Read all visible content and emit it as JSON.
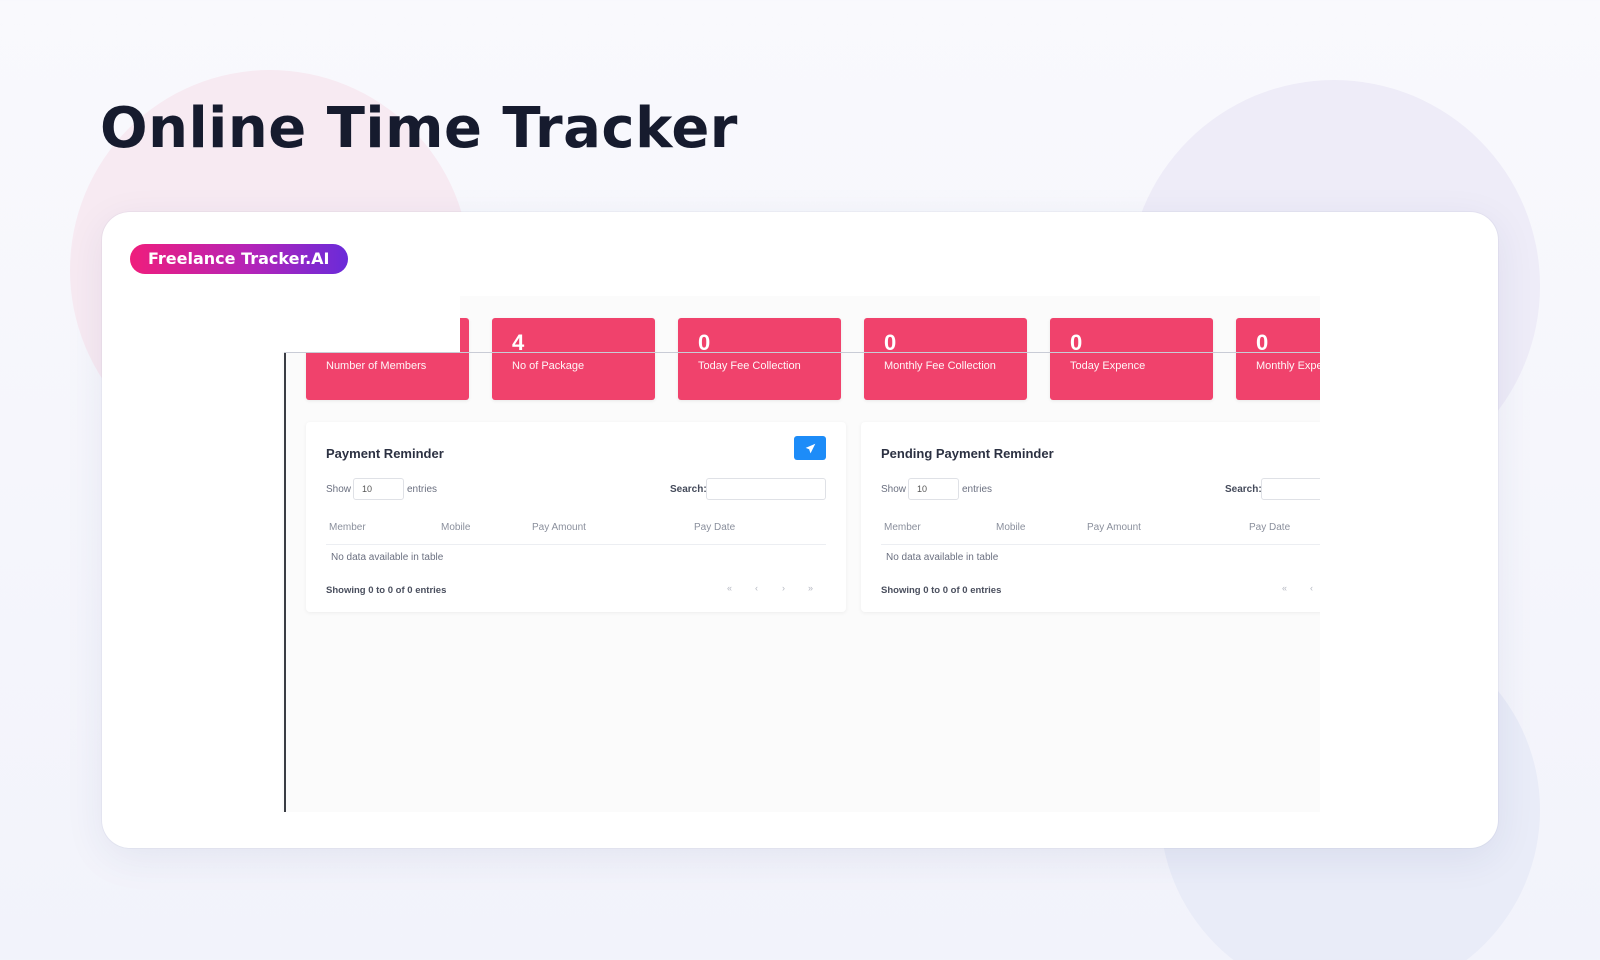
{
  "page": {
    "title": "Online Time Tracker"
  },
  "badge": {
    "label": "Freelance Tracker.AI"
  },
  "dashboard": {
    "stats": [
      {
        "value": "",
        "label": "Number of Members"
      },
      {
        "value": "4",
        "label": "No of Package"
      },
      {
        "value": "0",
        "label": "Today Fee Collection"
      },
      {
        "value": "0",
        "label": "Monthly Fee Collection"
      },
      {
        "value": "0",
        "label": "Today Expence"
      },
      {
        "value": "0",
        "label": "Monthly Expence"
      }
    ],
    "panels": [
      {
        "title": "Payment Reminder",
        "show_label": "Show",
        "entries_value": "10",
        "entries_label": "entries",
        "search_label": "Search:",
        "columns": [
          "Member",
          "Mobile",
          "Pay Amount",
          "Pay Date"
        ],
        "empty_text": "No data available in table",
        "info": "Showing 0 to 0 of 0 entries",
        "pager": [
          "«",
          "‹",
          "›",
          "»"
        ]
      },
      {
        "title": "Pending Payment Reminder",
        "show_label": "Show",
        "entries_value": "10",
        "entries_label": "entries",
        "search_label": "Search:",
        "columns": [
          "Member",
          "Mobile",
          "Pay Amount",
          "Pay Date"
        ],
        "empty_text": "No data available in table",
        "info": "Showing 0 to 0 of 0 entries",
        "pager": [
          "«",
          "‹",
          "›",
          "»"
        ]
      }
    ],
    "icons": {
      "send": "paper-plane-icon"
    },
    "colors": {
      "stat_card": "#f0426c",
      "send_button": "#1d8cf8",
      "badge_from": "#ef1d7c",
      "badge_to": "#6a2bd9"
    }
  }
}
